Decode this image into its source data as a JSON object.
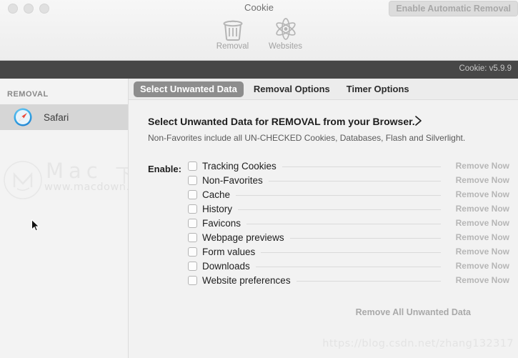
{
  "window": {
    "title": "Cookie",
    "traffic_lights": [
      "close",
      "minimize",
      "zoom"
    ]
  },
  "toolbar": {
    "items": [
      {
        "label": "Removal",
        "icon": "trash-icon"
      },
      {
        "label": "Websites",
        "icon": "atom-icon"
      }
    ],
    "auto_removal_button": "Enable Automatic Removal"
  },
  "version_band": {
    "text": "Cookie: v5.9.9"
  },
  "sidebar": {
    "header": "REMOVAL",
    "items": [
      {
        "label": "Safari",
        "icon": "safari-icon",
        "selected": true
      }
    ]
  },
  "tabs": [
    {
      "label": "Select Unwanted Data",
      "active": true
    },
    {
      "label": "Removal Options",
      "active": false
    },
    {
      "label": "Timer Options",
      "active": false
    }
  ],
  "panel": {
    "title": "Select Unwanted Data for REMOVAL from your Browser.",
    "chevron_icon": "chevron-right-icon",
    "subtitle": "Non-Favorites include all UN-CHECKED Cookies, Databases, Flash and Silverlight.",
    "enable_label": "Enable:",
    "remove_now_label": "Remove Now",
    "remove_all_label": "Remove All Unwanted Data",
    "options": [
      {
        "label": "Tracking Cookies",
        "checked": false
      },
      {
        "label": "Non-Favorites",
        "checked": false
      },
      {
        "label": "Cache",
        "checked": false
      },
      {
        "label": "History",
        "checked": false
      },
      {
        "label": "Favicons",
        "checked": false
      },
      {
        "label": "Webpage previews",
        "checked": false
      },
      {
        "label": "Form values",
        "checked": false
      },
      {
        "label": "Downloads",
        "checked": false
      },
      {
        "label": "Website preferences",
        "checked": false
      }
    ]
  },
  "watermarks": {
    "site_word": "Mac",
    "site_cjk": "下载",
    "site_url": "www.macdown.com",
    "blog_url": "https://blog.csdn.net/zhang132317"
  },
  "colors": {
    "accent_tab": "#8d8d8d",
    "dark_band": "#474747",
    "sidebar_selected": "#d6d6d6"
  }
}
